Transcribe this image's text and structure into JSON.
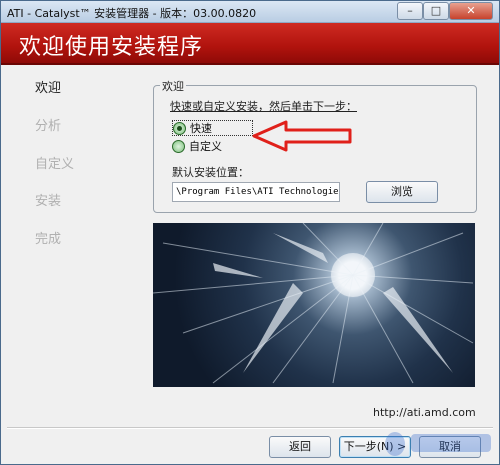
{
  "window": {
    "title": "ATI - Catalyst™ 安装管理器 - 版本：03.00.0820",
    "minimize": "–",
    "maximize": "□",
    "close": "✕"
  },
  "banner": {
    "title": "欢迎使用安装程序"
  },
  "steps": [
    "欢迎",
    "分析",
    "自定义",
    "安装",
    "完成"
  ],
  "active_step": "欢迎",
  "welcome": {
    "group_title": "欢迎",
    "instruction": "快速或自定义安装，然后单击下一步：",
    "options": [
      {
        "label": "快速",
        "selected": true
      },
      {
        "label": "自定义",
        "selected": false
      }
    ],
    "location_label": "默认安装位置：",
    "location_value": "\\Program Files\\ATI Technologies",
    "browse_label": "浏览"
  },
  "url_text": "http://ati.amd.com",
  "buttons": {
    "back_label": "返回",
    "next_label": "下一步(N) >",
    "cancel_label": "取消"
  },
  "colors": {
    "banner_red": "#b0130d",
    "annotation_arrow": "#e0201a",
    "radio_green": "#7bbf7b"
  },
  "icons": {
    "arrow": "red-annotation-arrow",
    "watermark": "baidu-watermark"
  }
}
